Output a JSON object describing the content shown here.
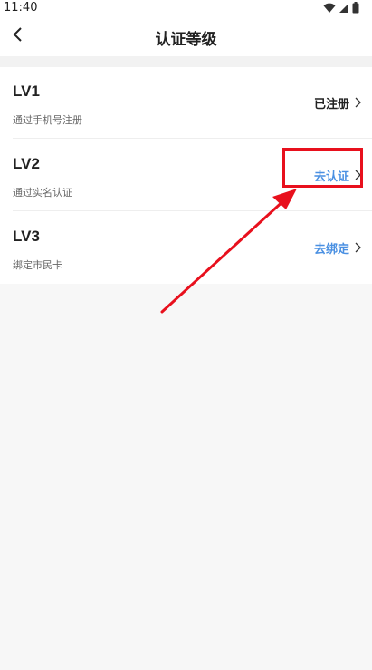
{
  "status_bar": {
    "time": "11:40",
    "icons": [
      "wifi-icon",
      "signal-icon",
      "battery-icon"
    ]
  },
  "navbar": {
    "back_icon": "chevron-left-icon",
    "title": "认证等级"
  },
  "levels": [
    {
      "name": "LV1",
      "description": "通过手机号注册",
      "action": "已注册",
      "action_state": "done"
    },
    {
      "name": "LV2",
      "description": "通过实名认证",
      "action": "去认证",
      "action_state": "pending"
    },
    {
      "name": "LV3",
      "description": "绑定市民卡",
      "action": "去绑定",
      "action_state": "pending"
    }
  ],
  "colors": {
    "accent": "#4a90e2",
    "annotation": "#e8101d",
    "background": "#f7f7f7"
  }
}
